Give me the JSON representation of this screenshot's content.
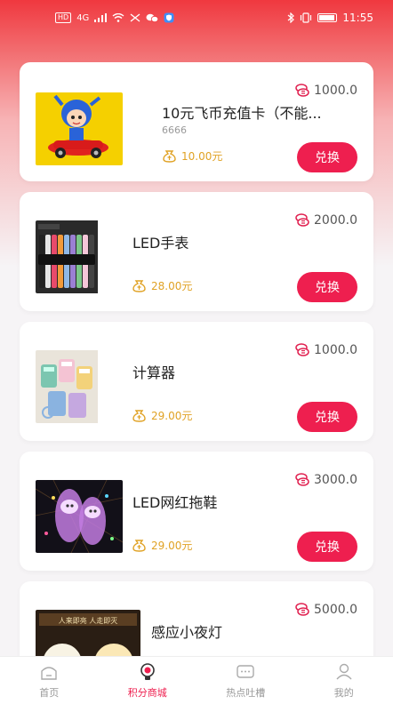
{
  "status_bar": {
    "left_indicators": [
      "HD",
      "4G"
    ],
    "time": "11:55",
    "icons": [
      "signal-icon",
      "wifi-icon",
      "scissors-icon",
      "chat-icon",
      "shield-icon",
      "bluetooth-icon",
      "vibrate-icon",
      "battery-icon"
    ]
  },
  "products": [
    {
      "name": "10元飞币充值卡（不能...",
      "desc": "6666",
      "points": "1000.0",
      "price": "10.00元",
      "button": "兑换"
    },
    {
      "name": "LED手表",
      "desc": "",
      "points": "2000.0",
      "price": "28.00元",
      "button": "兑换"
    },
    {
      "name": "计算器",
      "desc": "",
      "points": "1000.0",
      "price": "29.00元",
      "button": "兑换"
    },
    {
      "name": "LED网红拖鞋",
      "desc": "",
      "points": "3000.0",
      "price": "29.00元",
      "button": "兑换"
    },
    {
      "name": "感应小夜灯",
      "desc": "",
      "points": "5000.0",
      "price": "",
      "button": "",
      "image_text": "人来即亮 人走即灭"
    }
  ],
  "tabs": [
    {
      "label": "首页",
      "icon": "home-icon",
      "active": false
    },
    {
      "label": "积分商城",
      "icon": "lightbulb-icon",
      "active": true
    },
    {
      "label": "热点吐槽",
      "icon": "message-icon",
      "active": false
    },
    {
      "label": "我的",
      "icon": "user-icon",
      "active": false
    }
  ],
  "colors": {
    "accent": "#ee1f4f",
    "price": "#e0a224",
    "header_gradient_top": "#f0383f"
  }
}
